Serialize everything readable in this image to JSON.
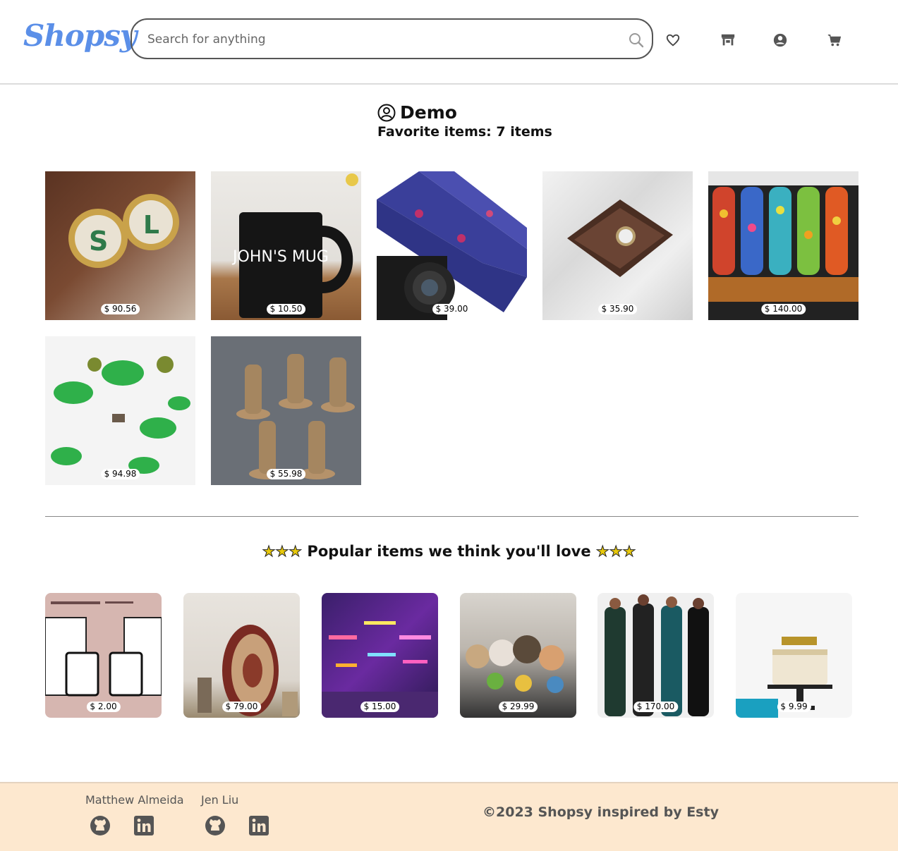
{
  "header": {
    "logo": "Shopsy",
    "search_placeholder": "Search for anything"
  },
  "profile": {
    "name": "Demo",
    "favorites_label": "Favorite items:",
    "favorites_count": "7 items"
  },
  "favorites": [
    {
      "price": "$ 90.56"
    },
    {
      "price": "$ 10.50",
      "mug_text": "JOHN'S MUG"
    },
    {
      "price": "$ 39.00"
    },
    {
      "price": "$ 35.90"
    },
    {
      "price": "$ 140.00"
    },
    {
      "price": "$ 94.98"
    },
    {
      "price": "$ 55.98"
    }
  ],
  "popular": {
    "title": "Popular items we think you'll love",
    "stars": "★★★",
    "items": [
      {
        "price": "$ 2.00"
      },
      {
        "price": "$ 79.00"
      },
      {
        "price": "$ 15.00"
      },
      {
        "price": "$ 29.99"
      },
      {
        "price": "$ 170.00"
      },
      {
        "price": "$ 9.99"
      }
    ]
  },
  "footer": {
    "developers": [
      {
        "name": "Matthew Almeida"
      },
      {
        "name": "Jen Liu"
      }
    ],
    "copyright": "©2023 Shopsy inspired by Esty"
  },
  "colors": {
    "logo": "#5b8fe8",
    "footer_bg": "#fde8cf",
    "icon": "#555555"
  }
}
